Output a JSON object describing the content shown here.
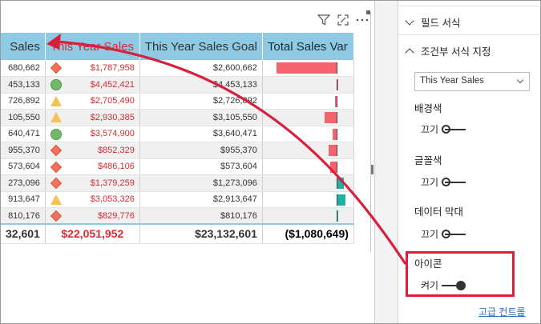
{
  "table": {
    "headers": [
      "Sales",
      "This Year Sales",
      "This Year Sales Goal",
      "Total Sales Var"
    ],
    "rows": [
      {
        "c1": "680,662",
        "icon": "diamond",
        "c2": "$1,787,958",
        "c3": "$2,600,662",
        "bar": -0.85,
        "barcolor": "#f4636e"
      },
      {
        "c1": "453,133",
        "icon": "circle",
        "c2": "$4,452,421",
        "c3": "$4,453,133",
        "bar": 0.0,
        "barcolor": "#f4636e"
      },
      {
        "c1": "726,892",
        "icon": "triangle",
        "c2": "$2,705,490",
        "c3": "$2,726,892",
        "bar": -0.02,
        "barcolor": "#f4636e"
      },
      {
        "c1": "105,550",
        "icon": "triangle",
        "c2": "$2,930,385",
        "c3": "$3,105,550",
        "bar": -0.17,
        "barcolor": "#f4636e"
      },
      {
        "c1": "640,471",
        "icon": "circle",
        "c2": "$3,574,900",
        "c3": "$3,640,471",
        "bar": -0.06,
        "barcolor": "#f4636e"
      },
      {
        "c1": "955,370",
        "icon": "diamond",
        "c2": "$852,329",
        "c3": "$955,370",
        "bar": -0.11,
        "barcolor": "#f4636e"
      },
      {
        "c1": "573,604",
        "icon": "diamond",
        "c2": "$486,106",
        "c3": "$573,604",
        "bar": -0.09,
        "barcolor": "#f4636e"
      },
      {
        "c1": "273,096",
        "icon": "diamond",
        "c2": "$1,379,259",
        "c3": "$1,273,096",
        "bar": 0.1,
        "barcolor": "#1bb4a4"
      },
      {
        "c1": "913,647",
        "icon": "triangle",
        "c2": "$3,053,326",
        "c3": "$2,913,647",
        "bar": 0.13,
        "barcolor": "#1bb4a4"
      },
      {
        "c1": "810,176",
        "icon": "diamond",
        "c2": "$829,776",
        "c3": "$810,176",
        "bar": 0.02,
        "barcolor": "#1bb4a4"
      }
    ],
    "total": {
      "c1": "32,601",
      "c2": "$22,051,952",
      "c3": "$23,132,601",
      "c4": "($1,080,649)"
    }
  },
  "pane": {
    "field_format": "필드 서식",
    "conditional_format": "조건부 서식 지정",
    "dropdown_value": "This Year Sales",
    "background_color": "배경색",
    "font_color": "글꼴색",
    "data_bars": "데이터 막대",
    "icons": "아이콘",
    "off_label": "끄기",
    "on_label": "켜기",
    "advanced_controls": "고급 컨트롤"
  },
  "colors": {
    "header_bg": "#8ecae3",
    "negative_bar": "#f4636e",
    "positive_bar": "#1bb4a4",
    "highlight": "#d81f3c",
    "link": "#2f6fb5"
  }
}
